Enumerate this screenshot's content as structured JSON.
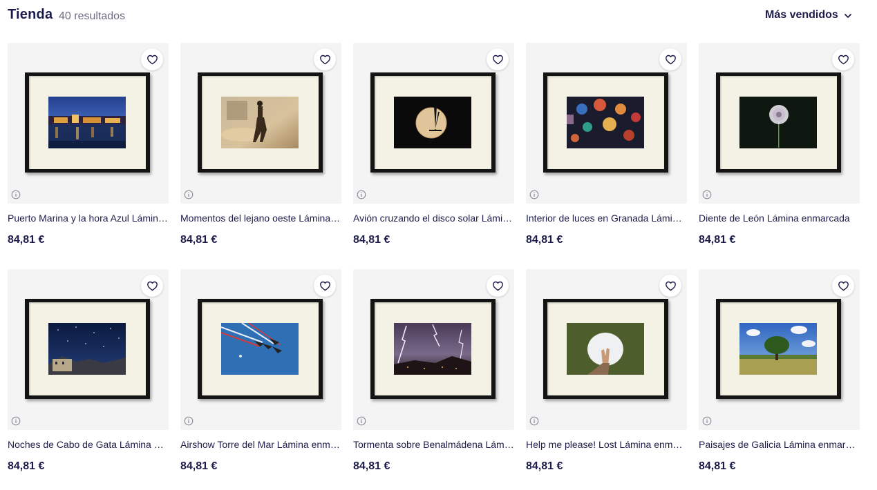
{
  "header": {
    "title": "Tienda",
    "count": "40 resultados",
    "sort_label": "Más vendidos"
  },
  "products": [
    {
      "name": "Puerto Marina y la hora Azul Lámina enmarcada",
      "price": "84,81 €",
      "photo": "night-harbor"
    },
    {
      "name": "Momentos del lejano oeste Lámina enmarcada",
      "price": "84,81 €",
      "photo": "western-rider"
    },
    {
      "name": "Avión cruzando el disco solar Lámina enmarcada",
      "price": "84,81 €",
      "photo": "plane-sun"
    },
    {
      "name": "Interior de luces en Granada Lámina enmarcada",
      "price": "84,81 €",
      "photo": "lamps"
    },
    {
      "name": "Diente de León Lámina enmarcada",
      "price": "84,81 €",
      "photo": "dandelion"
    },
    {
      "name": "Noches de Cabo de Gata Lámina enmarcada",
      "price": "84,81 €",
      "photo": "starry-night"
    },
    {
      "name": "Airshow Torre del Mar Lámina enmarcada",
      "price": "84,81 €",
      "photo": "airshow"
    },
    {
      "name": "Tormenta sobre Benalmádena Lámina enmarcada",
      "price": "84,81 €",
      "photo": "lightning"
    },
    {
      "name": "Help me please! Lost Lámina enmarcada",
      "price": "84,81 €",
      "photo": "hand-hole"
    },
    {
      "name": "Paisajes de Galicia Lámina enmarcada",
      "price": "84,81 €",
      "photo": "tree-field"
    }
  ]
}
